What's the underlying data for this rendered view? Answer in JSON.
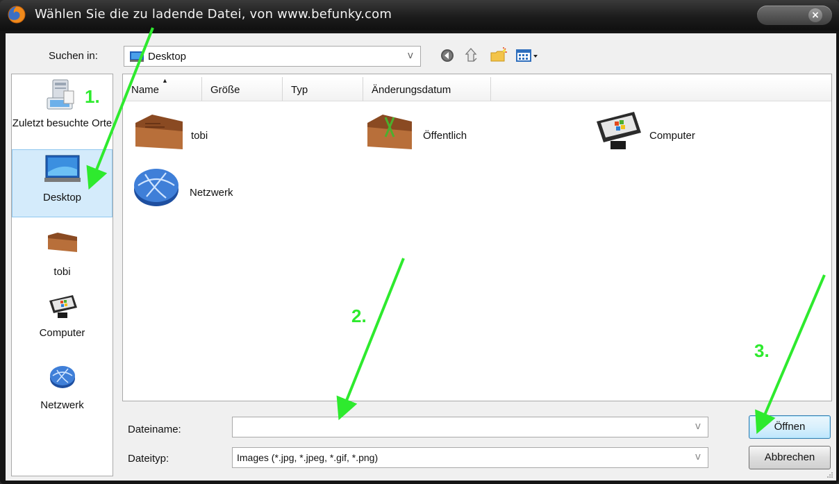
{
  "window": {
    "title": "Wählen Sie die zu ladende Datei, von www.befunky.com",
    "close_label": "×"
  },
  "lookin": {
    "label": "Suchen in:",
    "value": "Desktop",
    "arrow": "v"
  },
  "toolbar": {
    "icons": [
      "back-icon",
      "up-folder-icon",
      "new-folder-icon",
      "view-menu-icon"
    ]
  },
  "places": [
    {
      "label": "Zuletzt besuchte Orte",
      "icon": "recent-places-icon"
    },
    {
      "label": "Desktop",
      "icon": "desktop-icon",
      "selected": true
    },
    {
      "label": "tobi",
      "icon": "user-folder-icon"
    },
    {
      "label": "Computer",
      "icon": "computer-icon"
    },
    {
      "label": "Netzwerk",
      "icon": "network-icon"
    }
  ],
  "columns": [
    "Name",
    "Größe",
    "Typ",
    "Änderungsdatum"
  ],
  "sort_mark": "▲",
  "items": [
    {
      "label": "tobi",
      "icon": "user-folder-icon"
    },
    {
      "label": "Öffentlich",
      "icon": "public-folder-icon"
    },
    {
      "label": "Computer",
      "icon": "computer-icon"
    },
    {
      "label": "Netzwerk",
      "icon": "network-icon"
    }
  ],
  "filename": {
    "label": "Dateiname:",
    "value": "",
    "arrow": "v"
  },
  "filetype": {
    "label": "Dateityp:",
    "value": "Images (*.jpg, *.jpeg, *.gif, *.png)",
    "arrow": "v"
  },
  "buttons": {
    "open": "Öffnen",
    "cancel": "Abbrechen"
  },
  "annotations": {
    "step1": "1.",
    "step2": "2.",
    "step3": "3.",
    "color": "#2eea2e"
  }
}
